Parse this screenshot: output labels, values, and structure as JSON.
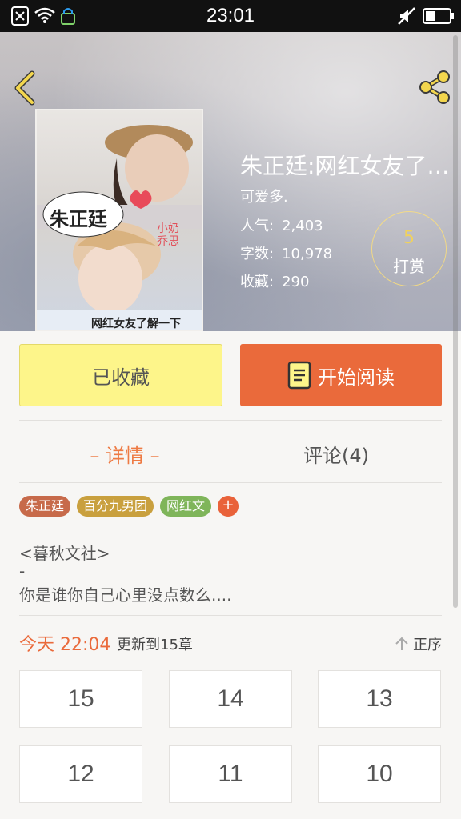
{
  "status_bar": {
    "time": "23:01"
  },
  "book": {
    "title": "朱正廷:网红女友了…",
    "author": "可爱多.",
    "stats": [
      {
        "label": "人气:",
        "value": "2,403"
      },
      {
        "label": "字数:",
        "value": "10,978"
      },
      {
        "label": "收藏:",
        "value": "290"
      }
    ],
    "reward": {
      "count": "5",
      "label": "打赏"
    },
    "cover_texts": {
      "name": "朱正廷",
      "side": "小奶乔思",
      "bottom": "网红女友了解一下"
    }
  },
  "actions": {
    "collected_label": "已收藏",
    "read_label": "开始阅读"
  },
  "tabs": {
    "details": "– 详情 –",
    "comments": "评论(4)"
  },
  "tags": [
    {
      "label": "朱正廷",
      "color": "#c76a4a"
    },
    {
      "label": "百分九男团",
      "color": "#c9a03e"
    },
    {
      "label": "网红文",
      "color": "#7fb55a"
    }
  ],
  "tag_add_label": "+",
  "description": {
    "line1": "<暮秋文社>",
    "line2": "-",
    "line3": "你是谁你自己心里没点数么...."
  },
  "update": {
    "time": "今天 22:04",
    "text": "更新到15章",
    "sort_label": "正序"
  },
  "chapters": [
    "15",
    "14",
    "13",
    "12",
    "11",
    "10"
  ],
  "colors": {
    "accent": "#ea6a3b",
    "collected_bg": "#fdf58a"
  }
}
